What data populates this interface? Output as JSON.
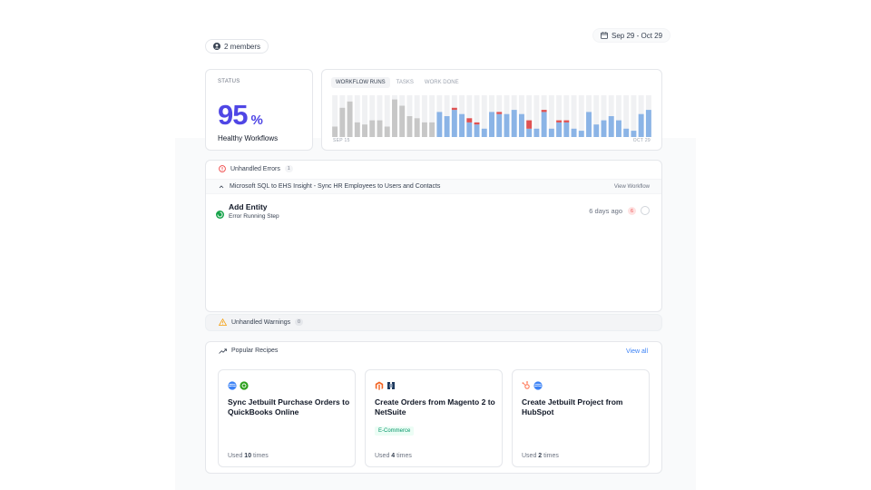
{
  "header": {
    "members_label": "2 members",
    "date_range": "Sep 29 - Oct 29"
  },
  "status": {
    "label": "STATUS",
    "percent": "95",
    "percent_sign": "%",
    "caption": "Healthy Workflows"
  },
  "chart_tabs": [
    "WORKFLOW RUNS",
    "TASKS",
    "WORK DONE"
  ],
  "chart_data": {
    "type": "bar",
    "x_start_label": "SEP 15",
    "x_end_label": "OCT 29",
    "colors": {
      "history": "#c7c7c7",
      "history_light": "#efefef",
      "success": "#8bb4e6",
      "error": "#e05252",
      "empty": "#f0f1f3"
    },
    "bars": [
      {
        "v": 0.25,
        "kind": "history",
        "err": 0
      },
      {
        "v": 0.7,
        "kind": "history",
        "err": 0
      },
      {
        "v": 0.85,
        "kind": "history",
        "err": 0
      },
      {
        "v": 0.35,
        "kind": "history",
        "err": 0
      },
      {
        "v": 0.3,
        "kind": "history",
        "err": 0
      },
      {
        "v": 0.4,
        "kind": "history",
        "err": 0
      },
      {
        "v": 0.4,
        "kind": "history",
        "err": 0
      },
      {
        "v": 0.25,
        "kind": "history",
        "err": 0
      },
      {
        "v": 0.9,
        "kind": "history",
        "err": 0
      },
      {
        "v": 0.75,
        "kind": "history",
        "err": 0
      },
      {
        "v": 0.5,
        "kind": "history",
        "err": 0
      },
      {
        "v": 0.45,
        "kind": "history",
        "err": 0
      },
      {
        "v": 0.35,
        "kind": "history",
        "err": 0
      },
      {
        "v": 0.35,
        "kind": "history",
        "err": 0
      },
      {
        "v": 0.6,
        "kind": "success",
        "err": 0
      },
      {
        "v": 0.5,
        "kind": "success",
        "err": 0
      },
      {
        "v": 0.65,
        "kind": "success",
        "err": 0.05
      },
      {
        "v": 0.55,
        "kind": "success",
        "err": 0
      },
      {
        "v": 0.35,
        "kind": "success",
        "err": 0.1
      },
      {
        "v": 0.3,
        "kind": "success",
        "err": 0.05
      },
      {
        "v": 0.2,
        "kind": "success",
        "err": 0
      },
      {
        "v": 0.6,
        "kind": "success",
        "err": 0
      },
      {
        "v": 0.55,
        "kind": "success",
        "err": 0.05
      },
      {
        "v": 0.55,
        "kind": "success",
        "err": 0
      },
      {
        "v": 0.65,
        "kind": "success",
        "err": 0
      },
      {
        "v": 0.55,
        "kind": "success",
        "err": 0
      },
      {
        "v": 0.2,
        "kind": "success",
        "err": 0.2
      },
      {
        "v": 0.2,
        "kind": "success",
        "err": 0
      },
      {
        "v": 0.6,
        "kind": "success",
        "err": 0.05
      },
      {
        "v": 0.2,
        "kind": "success",
        "err": 0
      },
      {
        "v": 0.35,
        "kind": "success",
        "err": 0.05
      },
      {
        "v": 0.35,
        "kind": "success",
        "err": 0.05
      },
      {
        "v": 0.2,
        "kind": "success",
        "err": 0
      },
      {
        "v": 0.15,
        "kind": "success",
        "err": 0
      },
      {
        "v": 0.6,
        "kind": "success",
        "err": 0
      },
      {
        "v": 0.3,
        "kind": "success",
        "err": 0
      },
      {
        "v": 0.4,
        "kind": "success",
        "err": 0
      },
      {
        "v": 0.5,
        "kind": "success",
        "err": 0
      },
      {
        "v": 0.4,
        "kind": "success",
        "err": 0
      },
      {
        "v": 0.2,
        "kind": "success",
        "err": 0
      },
      {
        "v": 0.15,
        "kind": "success",
        "err": 0
      },
      {
        "v": 0.55,
        "kind": "success",
        "err": 0
      },
      {
        "v": 0.65,
        "kind": "success",
        "err": 0
      }
    ]
  },
  "errors": {
    "title": "Unhandled Errors",
    "count": "1",
    "workflow_name": "Microsoft SQL to EHS Insight - Sync HR Employees to Users and Contacts",
    "view_workflow": "View Workflow",
    "entity_title": "Add Entity",
    "entity_subtitle": "Error Running Step",
    "age": "6 days ago",
    "error_badge": "6"
  },
  "warnings": {
    "title": "Unhandled Warnings",
    "count": "0"
  },
  "recipes": {
    "title": "Popular Recipes",
    "view_all": "View all",
    "items": [
      {
        "title": "Sync Jetbuilt Purchase Orders to QuickBooks Online",
        "used_prefix": "Used",
        "used_count": "10",
        "used_suffix": "times",
        "tag": ""
      },
      {
        "title": "Create Orders from Magento 2 to NetSuite",
        "used_prefix": "Used",
        "used_count": "4",
        "used_suffix": "times",
        "tag": "E-Commerce"
      },
      {
        "title": "Create Jetbuilt Project from HubSpot",
        "used_prefix": "Used",
        "used_count": "2",
        "used_suffix": "times",
        "tag": ""
      }
    ]
  }
}
